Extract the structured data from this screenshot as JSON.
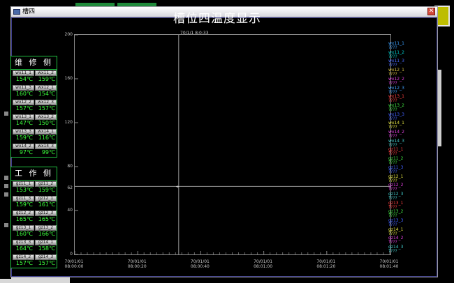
{
  "window": {
    "title": "槽四",
    "close_icon": "close-icon"
  },
  "page_title": "槽位四温度显示",
  "maintenance": {
    "heading": "维 修 侧",
    "cells": [
      {
        "label": "wx11_1",
        "value": "154℃"
      },
      {
        "label": "wx11_2",
        "value": "159℃"
      },
      {
        "label": "wx11_3",
        "value": "160℃"
      },
      {
        "label": "wx12_1",
        "value": "154℃"
      },
      {
        "label": "wx12_2",
        "value": "157℃"
      },
      {
        "label": "wx12_3",
        "value": "157℃"
      },
      {
        "label": "wx13_1",
        "value": "147℃"
      },
      {
        "label": "wx13_2",
        "value": "150℃"
      },
      {
        "label": "wx13_3",
        "value": "159℃"
      },
      {
        "label": "wx14_1",
        "value": "116℃"
      },
      {
        "label": "wx14_2",
        "value": "97℃"
      },
      {
        "label": "wx14_3",
        "value": "99℃"
      }
    ]
  },
  "working": {
    "heading": "工 作 侧",
    "cells": [
      {
        "label": "gz11_1",
        "value": "153℃"
      },
      {
        "label": "gz11_2",
        "value": "159℃"
      },
      {
        "label": "gz11_3",
        "value": "159℃"
      },
      {
        "label": "gz12_1",
        "value": "161℃"
      },
      {
        "label": "gz12_2",
        "value": "165℃"
      },
      {
        "label": "gz12_3",
        "value": "165℃"
      },
      {
        "label": "gz13_1",
        "value": "160℃"
      },
      {
        "label": "gz13_2",
        "value": "166℃"
      },
      {
        "label": "gz13_3",
        "value": "164℃"
      },
      {
        "label": "gz14_1",
        "value": "158℃"
      },
      {
        "label": "gz14_2",
        "value": "157℃"
      },
      {
        "label": "gz14_3",
        "value": "157℃"
      }
    ]
  },
  "chart_data": {
    "type": "line",
    "y_ticks": [
      "200",
      "160",
      "120",
      "80",
      "40",
      "0"
    ],
    "ylim": [
      0,
      200
    ],
    "x_ticks": [
      {
        "date": "70/01/01",
        "time": "08:00:00"
      },
      {
        "date": "70/01/01",
        "time": "08:00:20"
      },
      {
        "date": "70/01/01",
        "time": "08:00:40"
      },
      {
        "date": "70/01/01",
        "time": "08:01:00"
      },
      {
        "date": "70/01/01",
        "time": "08:01:20"
      },
      {
        "date": "70/01/01",
        "time": "08:01:40"
      }
    ],
    "cursor_time": "70/1/1 8:0:33",
    "cursor_value": "62",
    "grid": false,
    "series": [
      {
        "name": "wx11_1",
        "value": "????",
        "color": "#3aa0ff"
      },
      {
        "name": "wx11_2",
        "value": "????",
        "color": "#00c8c8"
      },
      {
        "name": "wx11_3",
        "value": "????",
        "color": "#4a6aff"
      },
      {
        "name": "wx12_1",
        "value": "????",
        "color": "#d8c040"
      },
      {
        "name": "wx12_2",
        "value": "????",
        "color": "#e040e0"
      },
      {
        "name": "wx12_3",
        "value": "????",
        "color": "#40a0ff"
      },
      {
        "name": "wx13_1",
        "value": "????",
        "color": "#ff4040"
      },
      {
        "name": "wx13_2",
        "value": "????",
        "color": "#40e040"
      },
      {
        "name": "wx13_3",
        "value": "????",
        "color": "#4060ff"
      },
      {
        "name": "wx14_1",
        "value": "????",
        "color": "#e0e040"
      },
      {
        "name": "wx14_2",
        "value": "????",
        "color": "#e040e0"
      },
      {
        "name": "wx14_3",
        "value": "????",
        "color": "#40c8c8"
      },
      {
        "name": "gz11_1",
        "value": "????",
        "color": "#ff4040"
      },
      {
        "name": "gz11_2",
        "value": "????",
        "color": "#40e040"
      },
      {
        "name": "gz11_3",
        "value": "????",
        "color": "#4060ff"
      },
      {
        "name": "gz12_1",
        "value": "????",
        "color": "#e0e040"
      },
      {
        "name": "gz12_2",
        "value": "????",
        "color": "#e040e0"
      },
      {
        "name": "gz12_3",
        "value": "????",
        "color": "#40c8c8"
      },
      {
        "name": "gz13_1",
        "value": "????",
        "color": "#ff4040"
      },
      {
        "name": "gz13_2",
        "value": "????",
        "color": "#40e040"
      },
      {
        "name": "gz13_3",
        "value": "????",
        "color": "#4060ff"
      },
      {
        "name": "gz14_1",
        "value": "????",
        "color": "#e0e040"
      },
      {
        "name": "gz14_2",
        "value": "????",
        "color": "#e040e0"
      },
      {
        "name": "gz14_3",
        "value": "????",
        "color": "#40c8c8"
      }
    ]
  }
}
